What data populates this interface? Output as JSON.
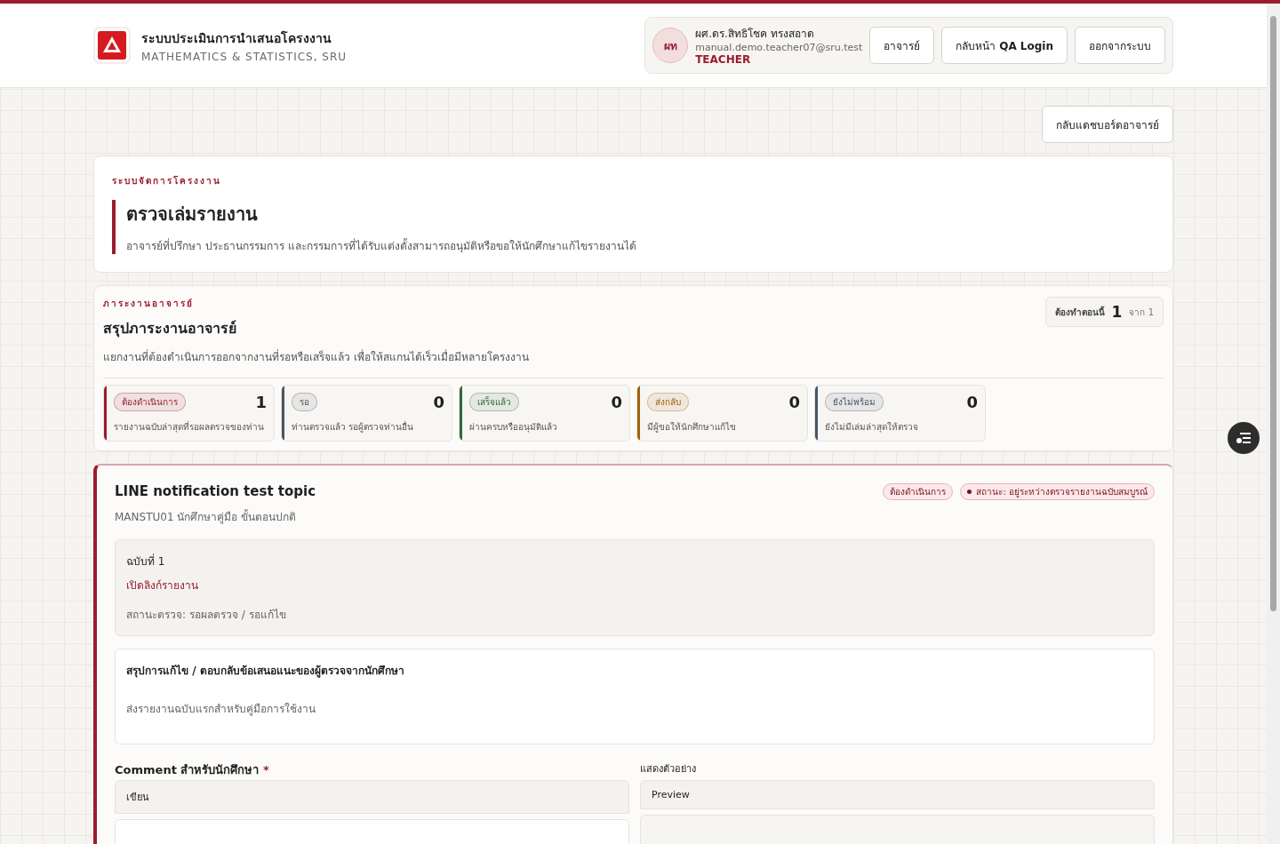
{
  "header": {
    "title": "ระบบประเมินการนำเสนอโครงงาน",
    "subtitle": "MATHEMATICS & STATISTICS, SRU",
    "user": {
      "initials": "ผท",
      "name": "ผศ.ดร.สิทธิโชค ทรงสอาด",
      "email": "manual.demo.teacher07@sru.test",
      "role": "TEACHER"
    },
    "buttons": [
      "อาจารย์",
      "กลับหน้า **QA Login**",
      "ออกจากระบบ"
    ]
  },
  "back_button": "กลับแดชบอร์ดอาจารย์",
  "intro": {
    "eyebrow": "ระบบจัดการโครงงาน",
    "title": "ตรวจเล่มรายงาน",
    "description": "อาจารย์ที่ปรึกษา ประธานกรรมการ และกรรมการที่ได้รับแต่งตั้งสามารถอนุมัติหรือขอให้นักศึกษาแก้ไขรายงานได้"
  },
  "summary": {
    "eyebrow": "ภาระงานอาจารย์",
    "title": "สรุปภาระงานอาจารย์",
    "description": "แยกงานที่ต้องดำเนินการออกจากงานที่รอหรือเสร็จแล้ว เพื่อให้สแกนได้เร็วเมื่อมีหลายโครงงาน",
    "now": {
      "label": "ต้องทำตอนนี้",
      "count": "1",
      "total": "จาก 1"
    },
    "cards": [
      {
        "badge": "ต้องดำเนินการ",
        "count": "1",
        "note": "รายงานฉบับล่าสุดที่รอผลตรวจของท่าน",
        "color": "#9b1c2e"
      },
      {
        "badge": "รอ",
        "count": "0",
        "note": "ท่านตรวจแล้ว รอผู้ตรวจท่านอื่น",
        "color": "#4b5563"
      },
      {
        "badge": "เสร็จแล้ว",
        "count": "0",
        "note": "ผ่านครบหรืออนุมัติแล้ว",
        "color": "#2f6b3a"
      },
      {
        "badge": "ส่งกลับ",
        "count": "0",
        "note": "มีผู้ขอให้นักศึกษาแก้ไข",
        "color": "#a16207"
      },
      {
        "badge": "ยังไม่พร้อม",
        "count": "0",
        "note": "ยังไม่มีเล่มล่าสุดให้ตรวจ",
        "color": "#475569"
      }
    ]
  },
  "project": {
    "title": "LINE notification test topic",
    "meta": "MANSTU01 นักศึกษาคู่มือ ขั้นตอนปกติ",
    "tags": [
      "ต้องดำเนินการ",
      "สถานะ: อยู่ระหว่างตรวจรายงานฉบับสมบูรณ์"
    ],
    "version": {
      "label": "ฉบับที่ 1",
      "link": "เปิดลิงก์รายงาน",
      "status": "สถานะตรวจ: รอผลตรวจ / รอแก้ไข"
    },
    "revision": {
      "title": "สรุปการแก้ไข / ตอบกลับข้อเสนอแนะของผู้ตรวจจากนักศึกษา",
      "text": "ส่งรายงานฉบับแรกสำหรับคู่มือการใช้งาน"
    },
    "comment": {
      "label": "Comment สำหรับนักศึกษา",
      "required": "*",
      "tab": "เขียน"
    },
    "preview": {
      "label": "แสดงตัวอย่าง",
      "tab": "Preview"
    }
  }
}
